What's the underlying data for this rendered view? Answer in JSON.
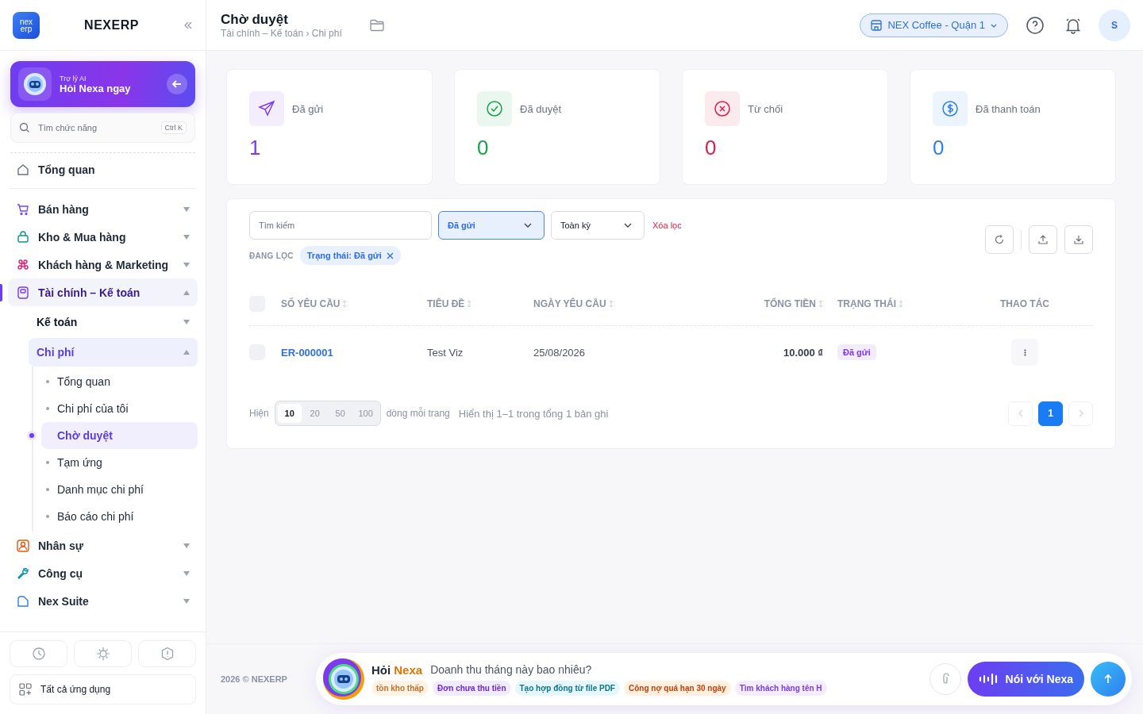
{
  "sidebar": {
    "logo_lines": [
      "nex",
      "erp"
    ],
    "brand": "NEXERP",
    "ai_card": {
      "caption": "Trợ lý AI",
      "title": "Hỏi Nexa ngay"
    },
    "search": {
      "placeholder": "Tìm chức năng",
      "shortcut": "Ctrl K"
    },
    "nav": [
      {
        "label": "Tổng quan",
        "selected": false
      },
      {
        "label": "Bán hàng",
        "selected": false,
        "expanded": false
      },
      {
        "label": "Kho & Mua hàng",
        "selected": false,
        "expanded": false
      },
      {
        "label": "Khách hàng & Marketing",
        "selected": false,
        "expanded": false
      },
      {
        "label": "Tài chính – Kế toán",
        "selected": true,
        "expanded": true,
        "children": [
          {
            "label": "Kế toán",
            "selected": false,
            "expanded": false
          },
          {
            "label": "Chi phí",
            "selected": true,
            "expanded": true,
            "children": [
              {
                "label": "Tổng quan",
                "selected": false
              },
              {
                "label": "Chi phí của tôi",
                "selected": false
              },
              {
                "label": "Chờ duyệt",
                "selected": true
              },
              {
                "label": "Tạm ứng",
                "selected": false
              },
              {
                "label": "Danh mục chi phí",
                "selected": false
              },
              {
                "label": "Báo cáo chi phí",
                "selected": false
              }
            ]
          }
        ]
      },
      {
        "label": "Nhân sự",
        "selected": false,
        "expanded": false
      },
      {
        "label": "Công cụ",
        "selected": false,
        "expanded": false
      },
      {
        "label": "Nex Suite",
        "selected": false,
        "expanded": false
      }
    ],
    "all_apps": "Tất cả ứng dụng"
  },
  "header": {
    "title": "Chờ duyệt",
    "breadcrumb": "Tài chính – Kế toán › Chi phí",
    "branch": "NEX Coffee - Quận 1",
    "avatar": "S"
  },
  "stats": [
    {
      "label": "Đã gửi",
      "value": "1",
      "color": "#7c3aed"
    },
    {
      "label": "Đã duyệt",
      "value": "0",
      "color": "#16a34a"
    },
    {
      "label": "Từ chối",
      "value": "0",
      "color": "#e11d48"
    },
    {
      "label": "Đã thanh toán",
      "value": "0",
      "color": "#2f80ed"
    }
  ],
  "filters": {
    "search_placeholder": "Tìm kiếm",
    "status": "Đã gửi",
    "period": "Toàn kỳ",
    "clear": "Xóa lọc",
    "active_label": "ĐANG LỌC",
    "chips": [
      "Trạng thái: Đã gửi"
    ]
  },
  "table": {
    "all_checked": false,
    "columns": [
      {
        "label": "SỐ YÊU CẦU",
        "sortable": true
      },
      {
        "label": "TIÊU ĐỀ",
        "sortable": true
      },
      {
        "label": "NGÀY YÊU CẦU",
        "sortable": true
      },
      {
        "label": "TỔNG TIỀN",
        "sortable": true
      },
      {
        "label": "TRẠNG THÁI",
        "sortable": true
      },
      {
        "label": "THAO TÁC",
        "sortable": false
      }
    ],
    "rows": [
      {
        "checked": false,
        "id": "ER-000001",
        "title": "Test Viz",
        "date": "25/08/2026",
        "amount": "10.000 ₫",
        "status": "Đã gửi"
      }
    ]
  },
  "pagination": {
    "show_label": "Hiện",
    "sizes": [
      {
        "label": "10",
        "selected": true
      },
      {
        "label": "20",
        "selected": false
      },
      {
        "label": "50",
        "selected": false
      },
      {
        "label": "100",
        "selected": false
      }
    ],
    "per_page": "dòng mỗi trang",
    "summary": "Hiển thị 1–1 trong tổng 1 bản ghi",
    "pages": [
      {
        "label": "1",
        "selected": true
      }
    ]
  },
  "footer": {
    "copyright": "2026 © NEXERP",
    "ask_prefix": "Hỏi",
    "ask_brand": "Nexa",
    "placeholder": "Doanh thu tháng này bao nhiêu?",
    "suggestions": [
      {
        "label": "tồn kho thấp",
        "color": "#fff3e6"
      },
      {
        "label": "Đơn chưa thu tiền",
        "color": "#f1ebff"
      },
      {
        "label": "Tạo hợp đồng từ file PDF",
        "color": "#e6f7fb"
      },
      {
        "label": "Công nợ quá hạn 30 ngày",
        "color": "#fff0e0"
      },
      {
        "label": "Tìm khách hàng tên H",
        "color": "#f3edff"
      }
    ],
    "voice_button": "Nói với Nexa"
  }
}
